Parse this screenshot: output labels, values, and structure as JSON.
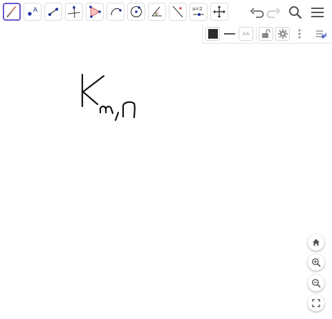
{
  "toolbar": {
    "tools": [
      {
        "id": "pen",
        "icon": "pen-icon",
        "active": true
      },
      {
        "id": "point",
        "icon": "point-icon",
        "label": "A"
      },
      {
        "id": "segment",
        "icon": "segment-icon"
      },
      {
        "id": "perpendicular",
        "icon": "perpendicular-line-icon"
      },
      {
        "id": "polygon",
        "icon": "polygon-icon"
      },
      {
        "id": "arc",
        "icon": "arc-icon"
      },
      {
        "id": "circle",
        "icon": "circle-icon"
      },
      {
        "id": "angle",
        "icon": "angle-icon",
        "label": "α"
      },
      {
        "id": "reflect",
        "icon": "reflect-icon"
      },
      {
        "id": "slider",
        "icon": "slider-icon",
        "label": "a=2"
      },
      {
        "id": "move",
        "icon": "move-graphics-icon"
      }
    ],
    "undo_icon": "undo-icon",
    "redo_icon": "redo-icon",
    "search_icon": "search-icon",
    "menu_icon": "menu-icon"
  },
  "style_bar": {
    "color": "#2b2b2b",
    "line_style": "solid",
    "text_size_label": "AA",
    "lock_icon": "unlock-icon",
    "settings_icon": "gear-icon",
    "more_icon": "more-vertical-icon",
    "toggle_icon": "style-bar-toggle-icon"
  },
  "canvas": {
    "ink_color": "#111111",
    "handwriting": "K m,n"
  },
  "zoom": {
    "home_icon": "home-icon",
    "zoom_in_icon": "zoom-in-icon",
    "zoom_out_icon": "zoom-out-icon",
    "fullscreen_icon": "fullscreen-icon"
  },
  "colors": {
    "accent": "#6557d2",
    "point_blue": "#1a2e9c",
    "polygon_red": "#d9524e"
  }
}
